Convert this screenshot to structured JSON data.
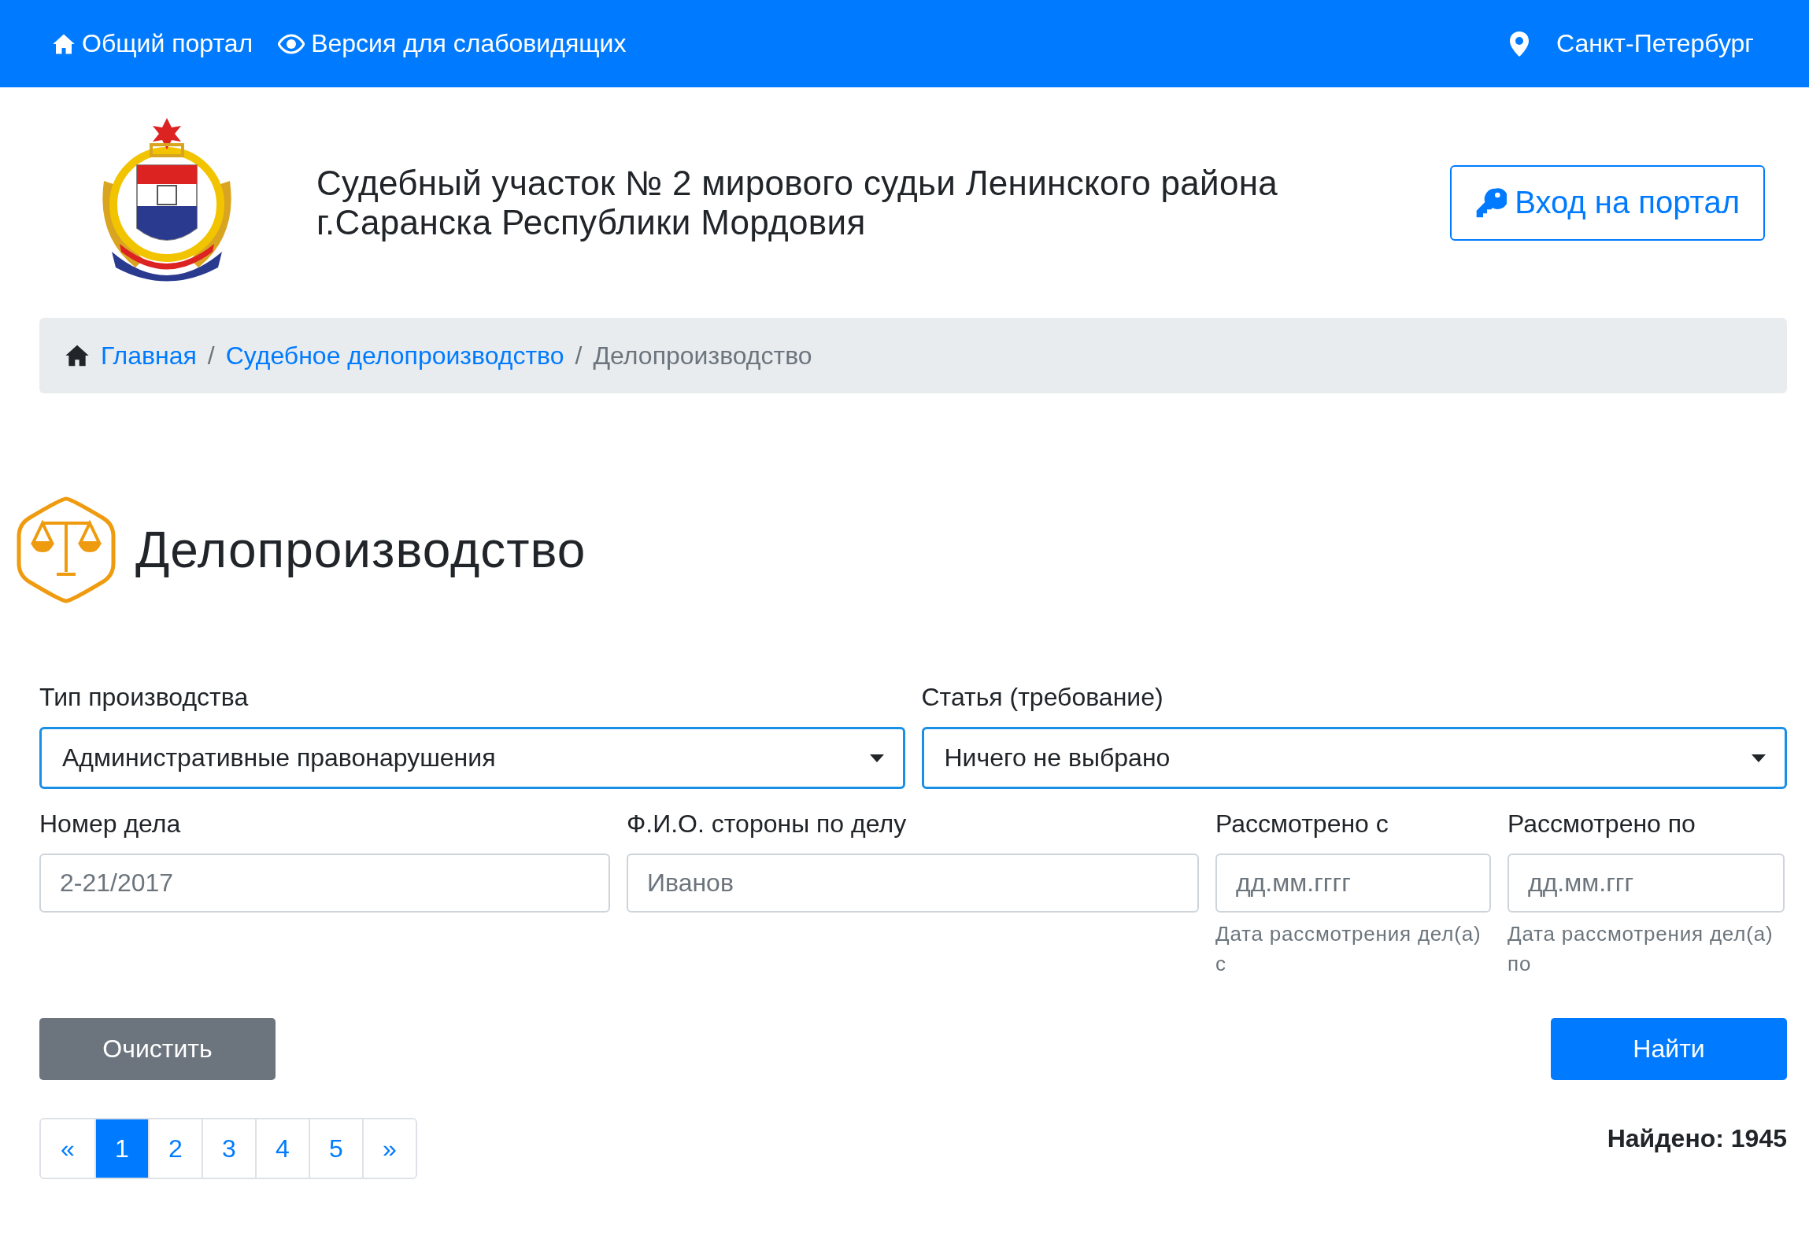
{
  "top_bar": {
    "links": [
      {
        "kind": "home",
        "label": "Общий портал"
      },
      {
        "kind": "eye",
        "label": "Версия для слабовидящих"
      }
    ],
    "city": "Санкт-Петербург"
  },
  "header": {
    "title": "Судебный участок № 2 мирового судьи Ленинского района г.Саранска Республики Мордовия",
    "login_button": "Вход на портал"
  },
  "breadcrumb_separator": "/",
  "breadcrumb": [
    {
      "label": "Главная",
      "current": false
    },
    {
      "label": "Судебное делопроизводство",
      "current": false
    },
    {
      "label": "Делопроизводство",
      "current": true
    }
  ],
  "page_title": "Делопроизводство",
  "selects": [
    {
      "label": "Тип производства",
      "value": "Административные правонарушения"
    },
    {
      "label": "Статья (требование)",
      "value": "Ничего не выбрано"
    }
  ],
  "inputs": [
    {
      "label": "Номер дела",
      "placeholder": "2-21/2017"
    },
    {
      "label": "Ф.И.О. стороны по делу",
      "placeholder": "Иванов"
    },
    {
      "label": "Рассмотрено с",
      "placeholder": "дд.мм.гггг",
      "help": "Дата рассмотрения дел(а) с"
    },
    {
      "label": "Рассмотрено по",
      "placeholder": "дд.мм.ггг",
      "help": "Дата рассмотрения дел(а) по"
    }
  ],
  "buttons": {
    "clear": "Очистить",
    "search": "Найти"
  },
  "pagination": [
    {
      "label": "«",
      "selected": false
    },
    {
      "label": "1",
      "selected": true
    },
    {
      "label": "2",
      "selected": false
    },
    {
      "label": "3",
      "selected": false
    },
    {
      "label": "4",
      "selected": false
    },
    {
      "label": "5",
      "selected": false
    },
    {
      "label": "»",
      "selected": false
    }
  ],
  "found": "Найдено: 1945"
}
